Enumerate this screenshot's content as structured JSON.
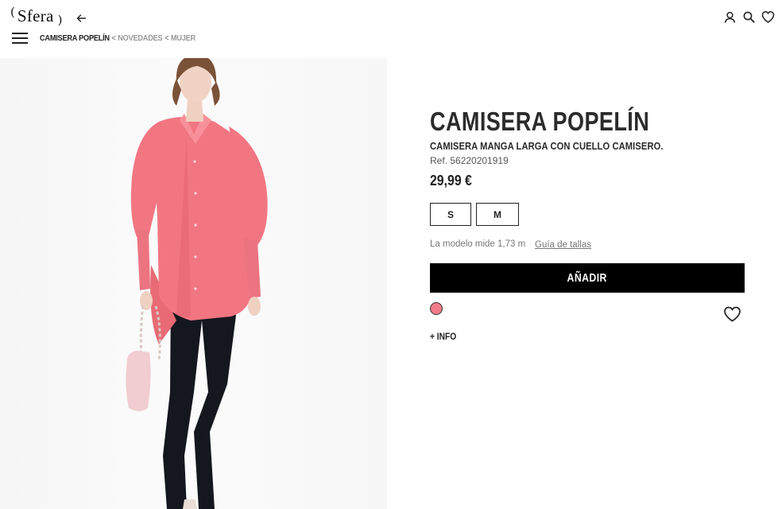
{
  "header": {
    "brand": "Sfera",
    "icons": [
      "back-arrow-icon",
      "user-icon",
      "search-icon",
      "heart-icon",
      "menu-icon"
    ]
  },
  "breadcrumb": {
    "current": "CAMISERA POPELÍN",
    "separator": "<",
    "items": [
      "NOVEDADES",
      "MUJER"
    ]
  },
  "product": {
    "title": "CAMISERA POPELÍN",
    "subtitle": "CAMISERA MANGA LARGA CON CUELLO CAMISERO.",
    "ref": "Ref. 56220201919",
    "price": "29,99 €",
    "sizes": [
      "S",
      "M"
    ],
    "model_note": "La modelo mide 1,73 m",
    "size_guide": "Guía de tallas",
    "add_button": "AÑADIR",
    "color_swatch": "#ef7c86",
    "more_info": "+ INFO"
  },
  "colors": {
    "accent": "#000000",
    "shirt": "#ef7c86"
  }
}
